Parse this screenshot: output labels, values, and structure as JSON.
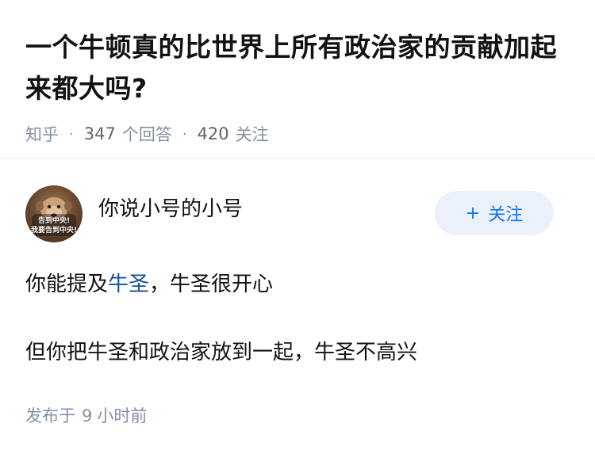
{
  "question": {
    "title": "一个牛顿真的比世界上所有政治家的贡献加起来都大吗?",
    "source": "知乎",
    "answer_count": "347",
    "answer_label": "个回答",
    "follower_count": "420",
    "follower_label": "关注"
  },
  "answer": {
    "author_name": "你说小号的小号",
    "avatar_caption_line1": "告到中央!",
    "avatar_caption_line2": "我要告到中央!",
    "follow_button": {
      "plus": "+",
      "label": "关注"
    },
    "paragraph1": {
      "before": "你能提及",
      "link": "牛圣",
      "after": "，牛圣很开心"
    },
    "paragraph2": "但你把牛圣和政治家放到一起，牛圣不高兴",
    "published": {
      "prefix": "发布于",
      "number": "9",
      "suffix": "小时前"
    }
  },
  "colors": {
    "link": "#175199",
    "follow_accent": "#1772f6",
    "follow_bg": "#ebf1fa",
    "meta_gray": "#8590a6"
  },
  "icons": {
    "avatar": "monkey-avatar-icon"
  }
}
